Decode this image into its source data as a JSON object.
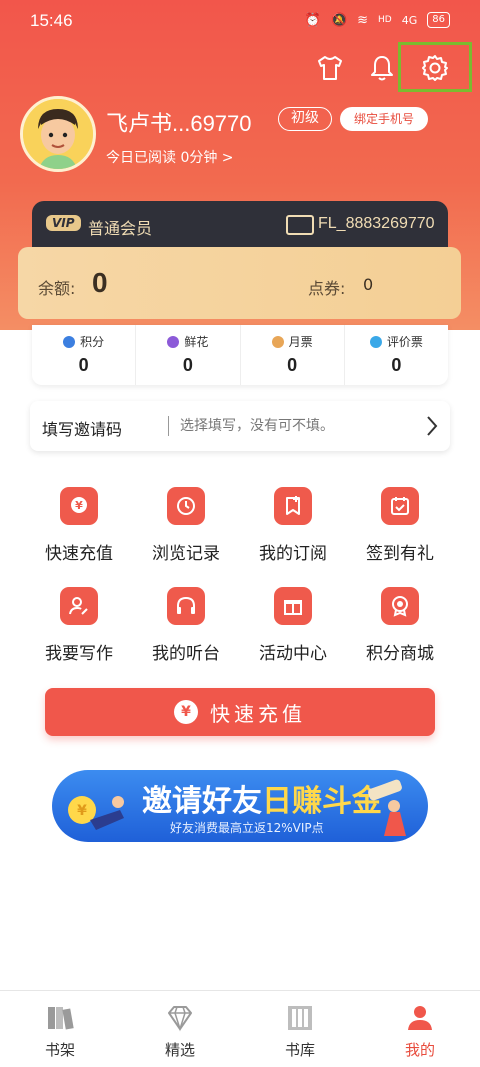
{
  "status_bar": {
    "time": "15:46",
    "network": "4G",
    "hd": "HD",
    "battery": "86"
  },
  "profile": {
    "name": "飞卢书...69770",
    "level": "初级",
    "bind_phone": "绑定手机号",
    "read_time": "今日已阅读 0分钟 >"
  },
  "vip": {
    "tag": "VIP",
    "label": "普通会员",
    "id": "FL_8883269770"
  },
  "balance": {
    "label": "余额:",
    "value": "0",
    "coupon_label": "点券:",
    "coupon_value": "0"
  },
  "stats": [
    {
      "label": "积分",
      "value": "0",
      "color": "#3c7fe0"
    },
    {
      "label": "鲜花",
      "value": "0",
      "color": "#8c5ad8"
    },
    {
      "label": "月票",
      "value": "0",
      "color": "#e8a657"
    },
    {
      "label": "评价票",
      "value": "0",
      "color": "#3aa8e8"
    }
  ],
  "invite": {
    "label": "填写邀请码",
    "placeholder": "选择填写，没有可不填。"
  },
  "grid": [
    {
      "label": "快速充值",
      "icon": "recharge-icon"
    },
    {
      "label": "浏览记录",
      "icon": "history-icon"
    },
    {
      "label": "我的订阅",
      "icon": "subscription-icon"
    },
    {
      "label": "签到有礼",
      "icon": "checkin-icon"
    },
    {
      "label": "我要写作",
      "icon": "write-icon"
    },
    {
      "label": "我的听台",
      "icon": "headphones-icon"
    },
    {
      "label": "活动中心",
      "icon": "gift-icon"
    },
    {
      "label": "积分商城",
      "icon": "points-mall-icon"
    }
  ],
  "recharge_button": {
    "icon": "¥",
    "label": "快速充值"
  },
  "banner": {
    "title_white": "邀请好友",
    "title_yellow": "日赚斗金",
    "subtitle": "好友消费最高立返12%VIP点"
  },
  "bottom_nav": [
    {
      "label": "书架",
      "icon": "bookshelf-icon"
    },
    {
      "label": "精选",
      "icon": "diamond-icon"
    },
    {
      "label": "书库",
      "icon": "library-icon"
    },
    {
      "label": "我的",
      "icon": "profile-icon",
      "active": true
    }
  ],
  "colors": {
    "accent": "#f0574b",
    "highlight": "#7cbb2f"
  }
}
